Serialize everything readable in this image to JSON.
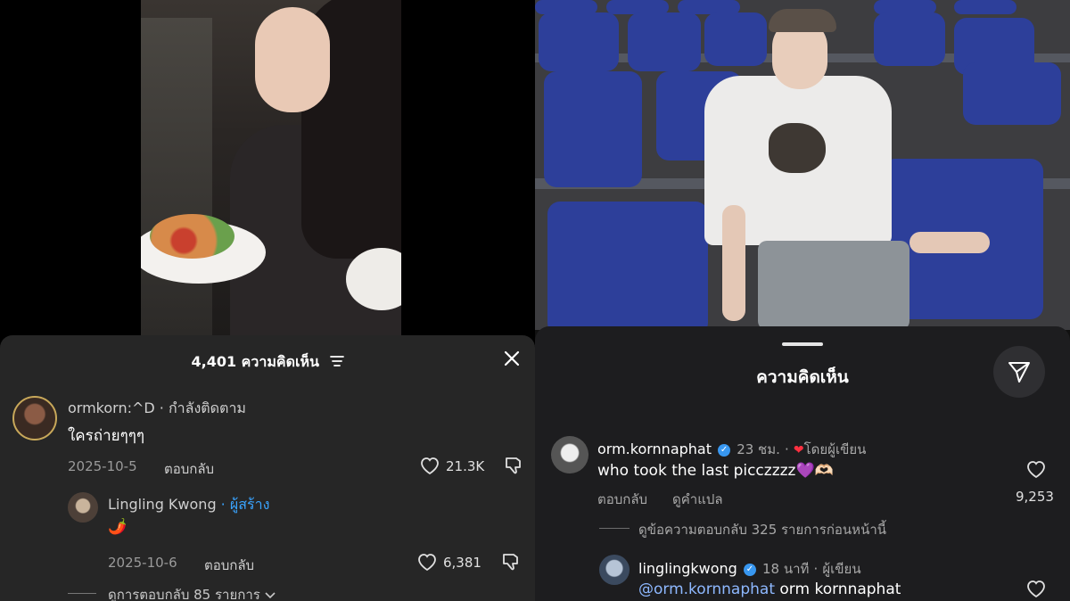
{
  "left": {
    "header": {
      "comment_count_label": "4,401 ความคิดเห็น"
    },
    "comments": [
      {
        "username": "ormkorn:^D",
        "status": " · กำลังติดตาม",
        "text": "ใครถ่ายๆๆๆ",
        "date": "2025-10-5",
        "reply_label": "ตอบกลับ",
        "likes": "21.3K"
      }
    ],
    "reply": {
      "username": "Lingling Kwong",
      "role": " · ผู้สร้าง",
      "text": "🌶️",
      "date": "2025-10-6",
      "reply_label": "ตอบกลับ",
      "likes": "6,381"
    },
    "view_replies": "ดูการตอบกลับ 85 รายการ"
  },
  "right": {
    "sheet_title": "ความคิดเห็น",
    "comment": {
      "username": "orm.kornnaphat",
      "time": "23 ชม.",
      "dot": "·",
      "liked_by_author": "โดยผู้เขียน",
      "text": "who took the last picczzzz💜🫶🏻",
      "reply_label": "ตอบกลับ",
      "translate_label": "ดูคำแปล",
      "likes": "9,253"
    },
    "view_previous_replies": "ดูข้อความตอบกลับ 325 รายการก่อนหน้านี้",
    "reply": {
      "username": "linglingkwong",
      "time": "18 นาที",
      "dot": "·",
      "role": "ผู้เขียน",
      "mention": "@orm.kornnaphat",
      "text": " orm kornnaphat"
    }
  },
  "colors": {
    "sheet_left_bg": "#262626",
    "sheet_right_bg": "#1d1d1f",
    "creator_blue": "#3aa4ff",
    "verified_blue": "#3897f0",
    "heart_red": "#ff3040"
  },
  "icons": [
    "filter-icon",
    "close-icon",
    "heart-icon",
    "dislike-icon",
    "send-icon",
    "verified-icon",
    "chevron-down-icon"
  ]
}
